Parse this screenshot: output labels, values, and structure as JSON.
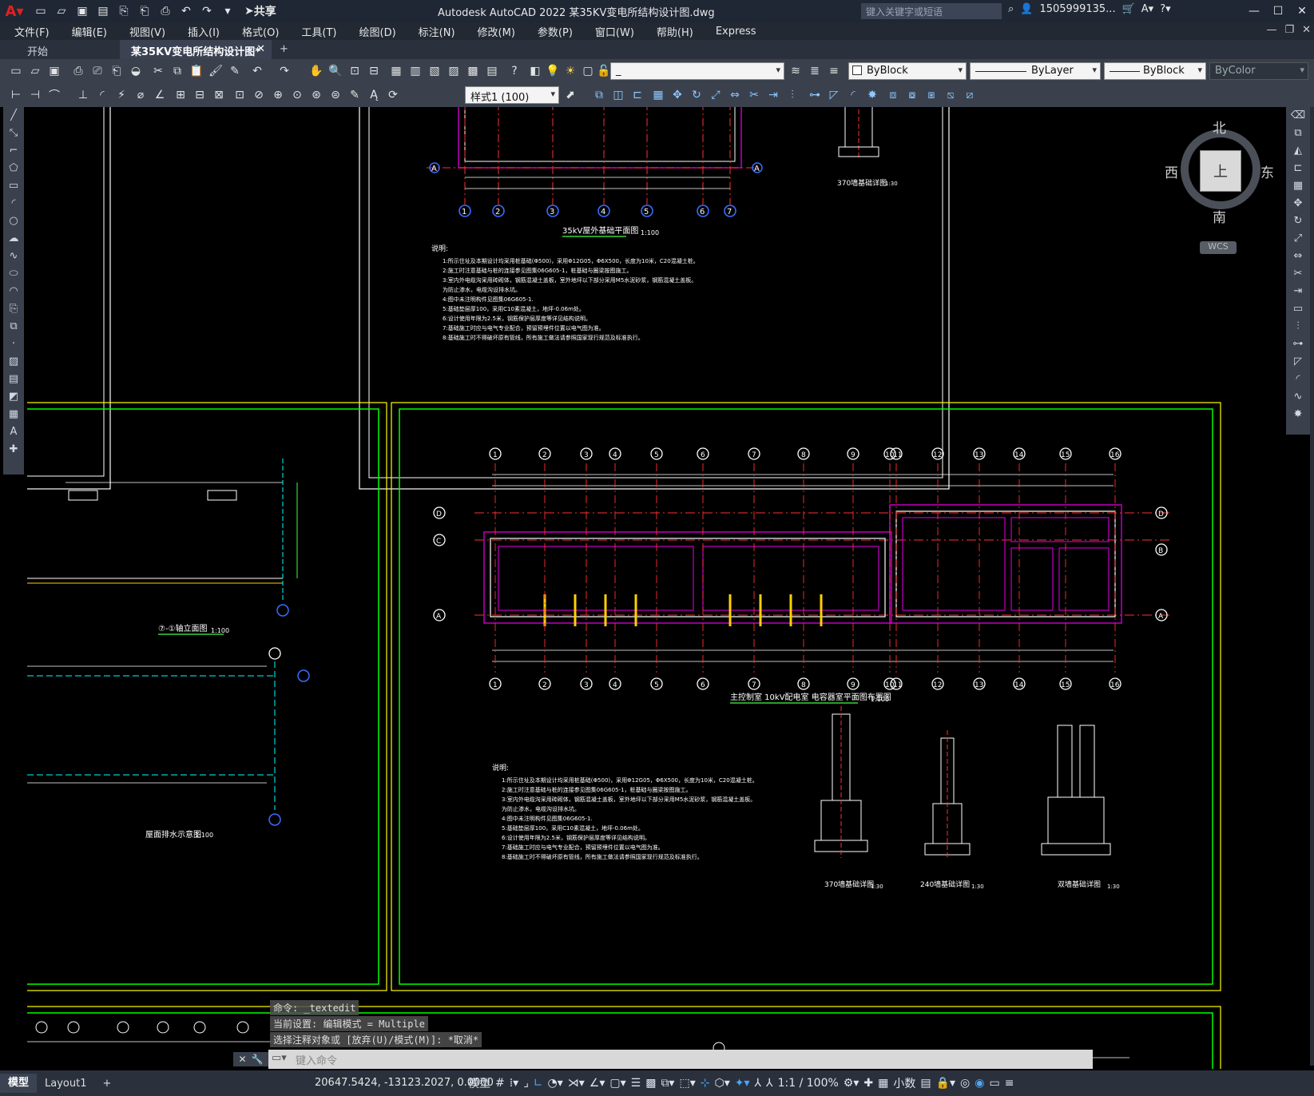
{
  "window": {
    "title": "Autodesk AutoCAD 2022    某35KV变电所结构设计图.dwg",
    "search_placeholder": "键入关键字或短语",
    "user": "1505999135...",
    "share_label": "共享"
  },
  "menu": [
    "文件(F)",
    "编辑(E)",
    "视图(V)",
    "插入(I)",
    "格式(O)",
    "工具(T)",
    "绘图(D)",
    "标注(N)",
    "修改(M)",
    "参数(P)",
    "窗口(W)",
    "帮助(H)",
    "Express"
  ],
  "tabs": {
    "start": "开始",
    "active": "某35KV变电所结构设计图*",
    "close": "✕",
    "new": "+"
  },
  "toolbar": {
    "layer_value": "_",
    "style_value": "样式1 (100)",
    "color_value": "ByBlock",
    "linetype_value": "ByLayer",
    "lineweight_value": "ByBlock",
    "plotstyle_value": "ByColor"
  },
  "viewcube": {
    "north": "北",
    "south": "南",
    "east": "东",
    "west": "西",
    "top": "上",
    "wcs": "WCS"
  },
  "drawing": {
    "sheet1_title": "35kV屋外基础平面图",
    "sheet1_scale": "1:100",
    "notes_heading": "说明:",
    "notes": [
      "1:所示住址及本期设计均采用桩基础(Φ500)，采用Φ12G05，Φ6X500，长度为10米，C20混凝土桩。",
      "2:施工时注意基础与桩的连接参见图集06G605-1，桩基础与圈梁按图施工。",
      "3:室内外电缆沟采用砖砌体，钢筋混凝土盖板，室外地坪以下部分采用M5水泥砂浆，钢筋混凝土盖板。",
      "   为防止渗水，电缆沟设排水坑。",
      "4:图中未注明构件见图集06G605-1.",
      "5:基础垫层厚100，采用C10素混凝土，地坪-0.06m处。",
      "6:设计使用年限为2.5米，钢筋保护层厚度等详见结构说明。",
      "7:基础施工时应与电气专业配合，预留预埋件位置以电气图为准。",
      "8:基础施工时不得破坏原有管线，所有施工做法请参照国家现行规范及标准执行。"
    ],
    "detail370": "370墙基础详图",
    "detail240": "240墙基础详图",
    "detail_double": "双墙基础详图",
    "detail_scale": "1:30",
    "main_plan_title": "主控制室 10kV配电室 电容器室平面图布置图",
    "main_plan_scale": "1:100",
    "elev_title": "⑦-①轴立面图",
    "elev_scale": "1:100",
    "roof_title": "屋面排水示意图",
    "roof_scale": "1:100",
    "grid_top": [
      "1",
      "2",
      "3",
      "4",
      "5",
      "6",
      "7"
    ],
    "grid_main": [
      "1",
      "2",
      "3",
      "4",
      "5",
      "6",
      "7",
      "8",
      "9",
      "10",
      "11",
      "12",
      "13",
      "14",
      "15",
      "16"
    ],
    "rows_main": [
      "D",
      "C",
      "A"
    ],
    "rows_right": [
      "D",
      "B",
      "A"
    ]
  },
  "command": {
    "history": [
      "命令:  _textedit",
      "当前设置: 编辑模式 = Multiple",
      "选择注释对象或 [放弃(U)/模式(M)]: *取消*"
    ],
    "placeholder": "键入命令"
  },
  "status": {
    "model_tab": "模型",
    "layout_tab": "Layout1",
    "coords": "20647.5424, -13123.2027, 0.0000",
    "model_btn": "模型",
    "scale": "1:1 / 100%",
    "units": "小数"
  }
}
